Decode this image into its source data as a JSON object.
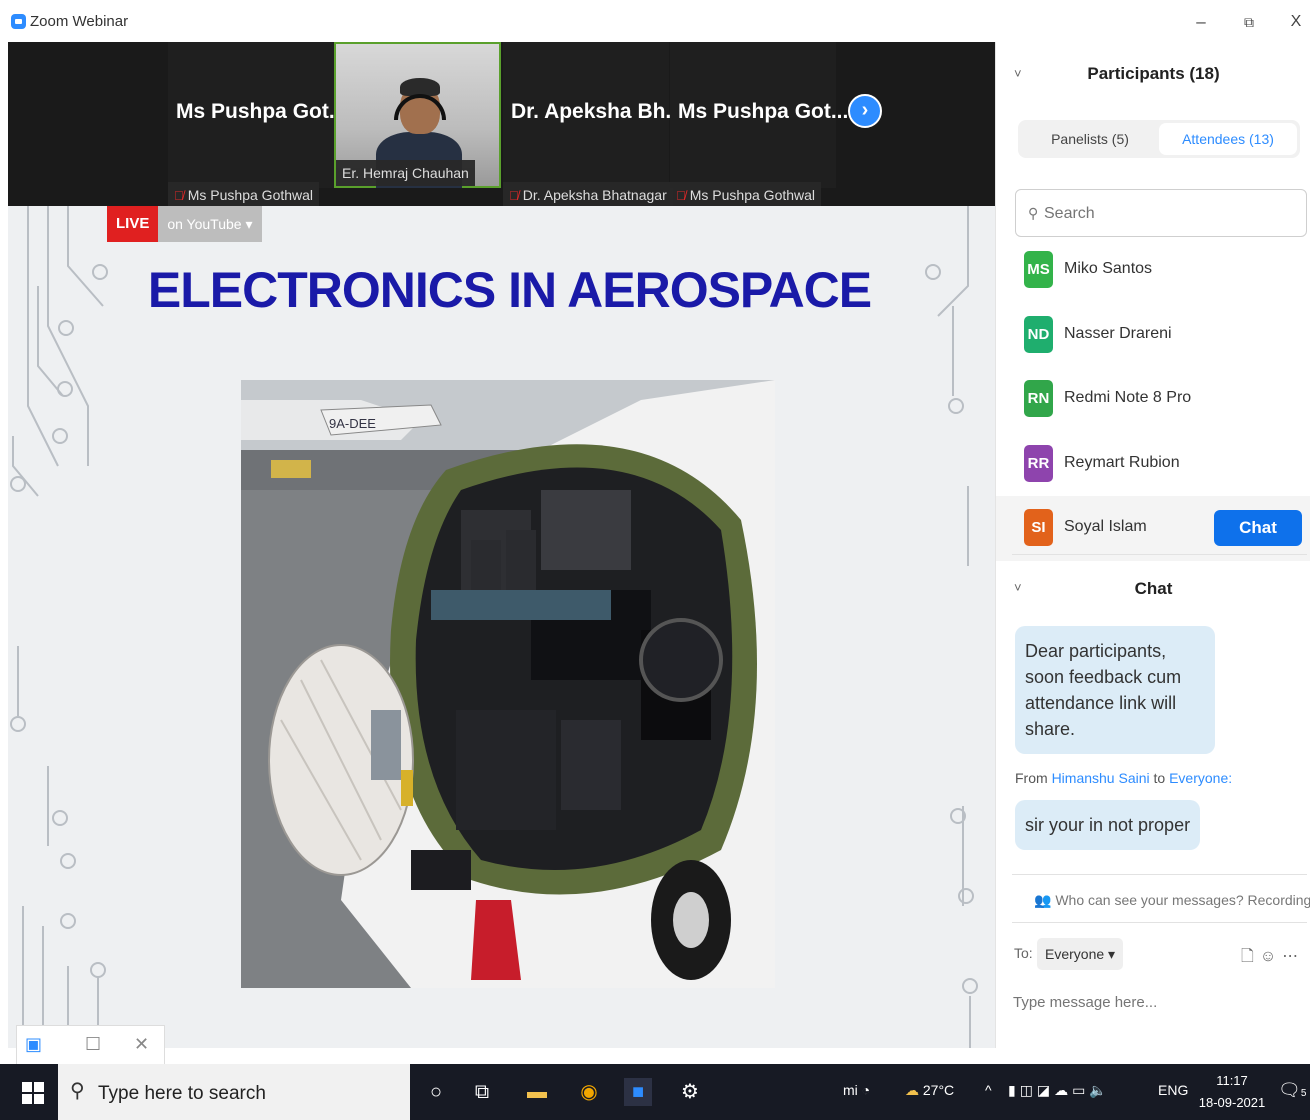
{
  "window": {
    "title": "Zoom Webinar",
    "minimize": "–",
    "restore": "⧉",
    "close": "X"
  },
  "videos": [
    {
      "name": "Ms Pushpa Got...",
      "label": "Ms Pushpa Gothwal",
      "muted": true
    },
    {
      "name": "",
      "label": "Er. Hemraj Chauhan",
      "muted": false
    },
    {
      "name": "Dr. Apeksha Bh...",
      "label": "Dr. Apeksha Bhatnagar",
      "muted": true
    },
    {
      "name": "Ms Pushpa Got...",
      "label": "Ms Pushpa Gothwal",
      "muted": true
    }
  ],
  "stream": {
    "live": "LIVE",
    "platform": "on YouTube ▾"
  },
  "slide": {
    "title": "ELECTRONICS IN AEROSPACE",
    "plane_reg": "9A-DEE"
  },
  "participants": {
    "title": "Participants (18)",
    "tabs": {
      "panelists": "Panelists (5)",
      "attendees": "Attendees (13)"
    },
    "search_placeholder": "Search",
    "list": [
      {
        "initials": "MS",
        "name": "Miko Santos",
        "color": "#33b34a"
      },
      {
        "initials": "ND",
        "name": "Nasser Drareni",
        "color": "#1fae6e"
      },
      {
        "initials": "RN",
        "name": "Redmi Note 8 Pro",
        "color": "#31a64a"
      },
      {
        "initials": "RR",
        "name": "Reymart Rubion",
        "color": "#8e44ad"
      },
      {
        "initials": "SI",
        "name": "Soyal Islam",
        "color": "#e2621b"
      }
    ],
    "chat_button": "Chat"
  },
  "chat": {
    "title": "Chat",
    "messages": [
      {
        "text": "Dear participants, soon feedback cum attendance link will share."
      },
      {
        "from_prefix": "From",
        "sender": "Himanshu Saini",
        "to_word": "to",
        "recipient": "Everyone:",
        "text": "sir your in not proper"
      }
    ],
    "privacy_note": "Who can see your messages? Recording On",
    "to_label": "To:",
    "to_value": "Everyone ▾",
    "input_placeholder": "Type message here..."
  },
  "taskbar": {
    "search_placeholder": "Type here to search",
    "temperature": "27°C",
    "language": "ENG",
    "time": "11:17",
    "date": "18-09-2021",
    "notifications": "5"
  },
  "colors": {
    "accent": "#2d8cff",
    "live": "#e02020",
    "slide_title": "#1a1aa8",
    "chat_bubble": "#dcecf7"
  }
}
